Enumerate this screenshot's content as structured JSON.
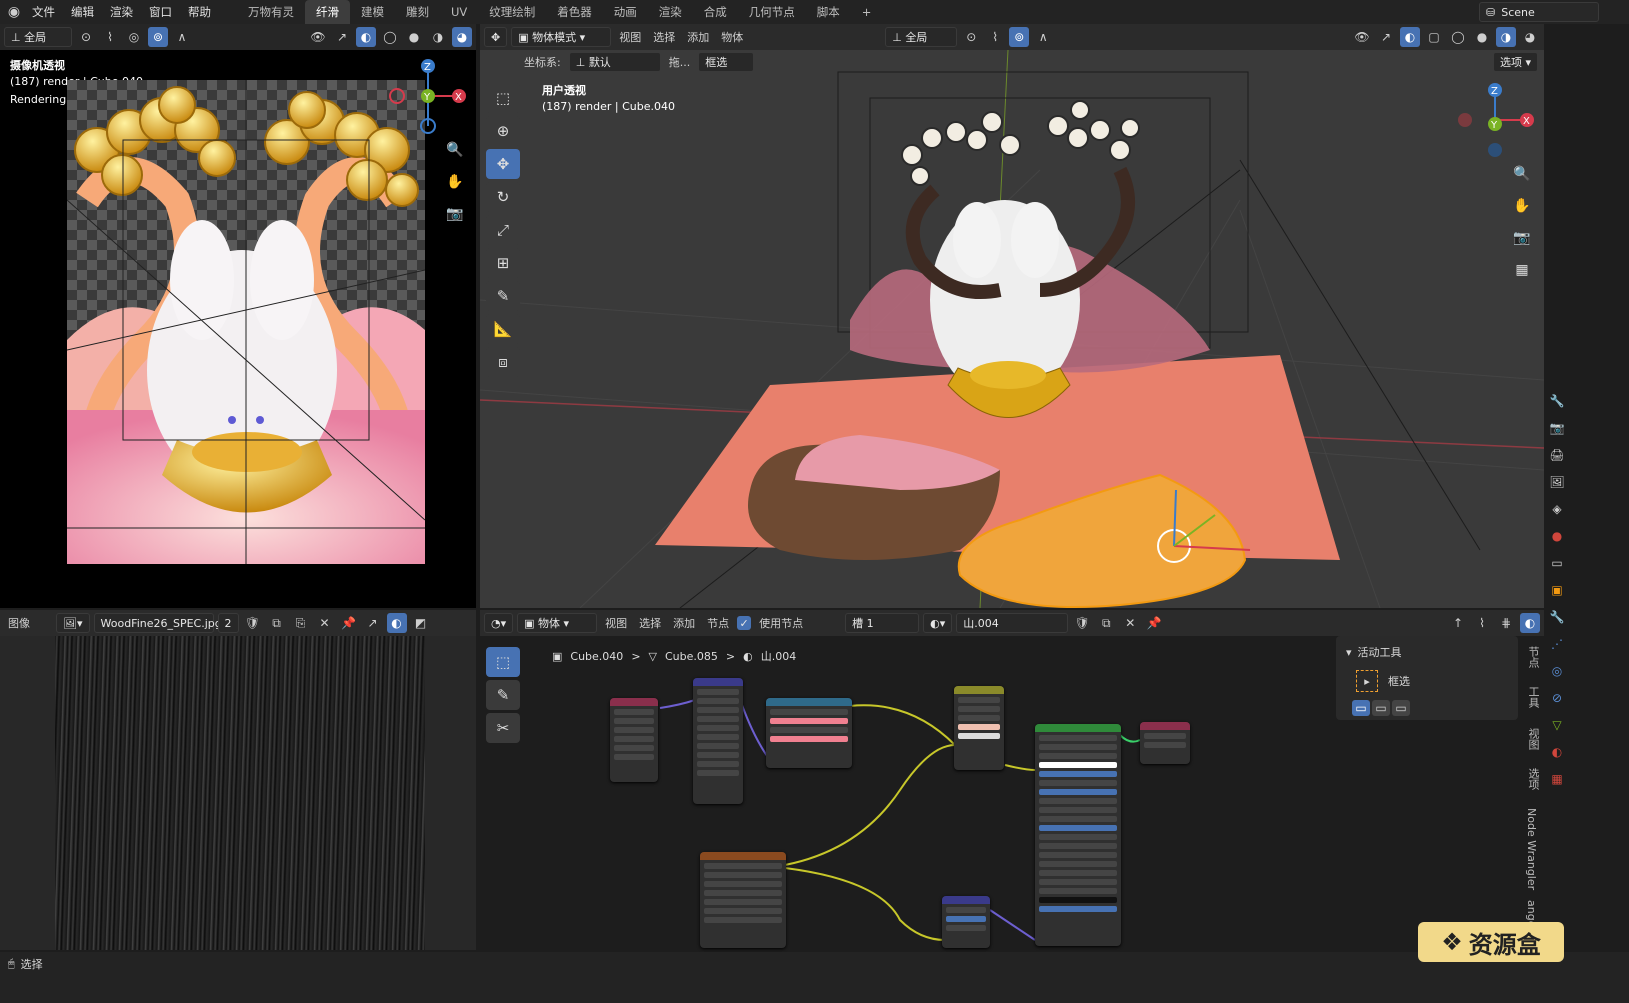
{
  "topbar": {
    "menus": [
      "文件",
      "编辑",
      "渲染",
      "窗口",
      "帮助"
    ],
    "workspaces": [
      "万物有灵",
      "纤滑",
      "建模",
      "雕刻",
      "UV",
      "纹理绘制",
      "着色器",
      "动画",
      "渲染",
      "合成",
      "几何节点",
      "脚本"
    ],
    "active_workspace": "纤滑",
    "add_tab": "+",
    "scene": "Scene"
  },
  "camera_view": {
    "header": {
      "transform": "全局"
    },
    "title": "摄像机透视",
    "info": "(187) render | Cube.040",
    "status": "Rendering Done"
  },
  "viewport": {
    "header": {
      "mode": "物体模式",
      "menus": [
        "视图",
        "选择",
        "添加",
        "物体"
      ],
      "transform": "全局",
      "options": "选项"
    },
    "subheader": {
      "coord_label": "坐标系:",
      "coord_value": "默认",
      "drag_label": "拖...",
      "select_mode": "框选"
    },
    "title": "用户透视",
    "info": "(187) render | Cube.040",
    "gizmo": {
      "x": "X",
      "y": "Y",
      "z": "Z"
    }
  },
  "image_editor": {
    "header": {
      "type": "图像",
      "image_name": "WoodFine26_SPEC.jpg",
      "users": "2"
    }
  },
  "node_editor": {
    "header": {
      "type": "物体",
      "menus": [
        "视图",
        "选择",
        "添加",
        "节点"
      ],
      "use_nodes": "使用节点",
      "slot": "槽 1",
      "material": "山.004"
    },
    "breadcrumb": [
      "Cube.040",
      "Cube.085",
      "山.004"
    ],
    "sep": ">",
    "panel": {
      "title": "活动工具",
      "tool": "框选"
    },
    "side_tabs": [
      "节点",
      "工具",
      "视图",
      "选项",
      "Node Wrangler",
      "ange"
    ]
  },
  "status": {
    "select": "选择"
  },
  "watermark": "资源盒",
  "colors": {
    "accent": "#4772b3",
    "bg": "#1d1d1d",
    "panel": "#2b2b2b",
    "node_yellow": "#c7c72a",
    "node_purple": "#6d5fd0",
    "floor": "#e8806c"
  }
}
